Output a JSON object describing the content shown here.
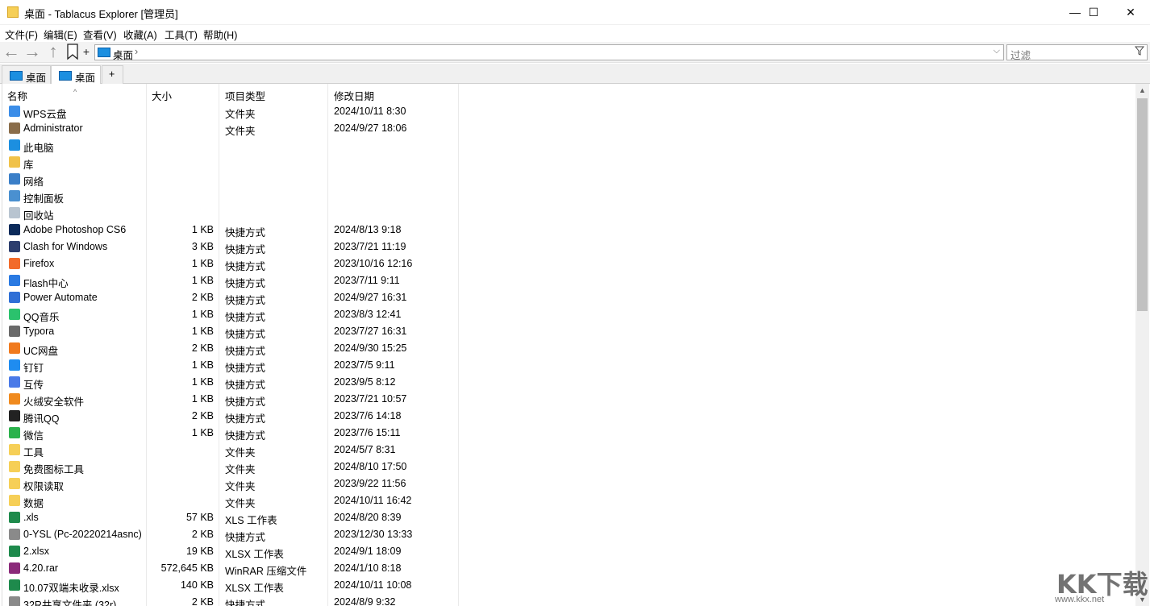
{
  "window": {
    "title": "桌面 - Tablacus Explorer [管理员]",
    "minimize": "—",
    "maximize": "☐",
    "close": "✕"
  },
  "menu": [
    "文件(F)",
    "编辑(E)",
    "查看(V)",
    "收藏(A)",
    "工具(T)",
    "帮助(H)"
  ],
  "nav": {
    "back": "←",
    "forward": "→",
    "up": "↑",
    "new_tab": "+"
  },
  "address": {
    "path": "桌面",
    "separator": "›",
    "dropdown": "⌵"
  },
  "filter": {
    "placeholder": "过滤",
    "icon": "filter-icon"
  },
  "tabs": [
    {
      "label": "桌面",
      "active": false
    },
    {
      "label": "桌面",
      "active": true
    },
    {
      "label": "+"
    }
  ],
  "columns": {
    "name": "名称",
    "size": "大小",
    "type": "项目类型",
    "date": "修改日期"
  },
  "files": [
    {
      "name": "WPS云盘",
      "size": "",
      "type": "文件夹",
      "date": "2024/10/11 8:30",
      "icon": "cloud-icon",
      "color": "#3b8de8"
    },
    {
      "name": "Administrator",
      "size": "",
      "type": "文件夹",
      "date": "2024/9/27 18:06",
      "icon": "user-folder-icon",
      "color": "#8a6d4a"
    },
    {
      "name": "此电脑",
      "size": "",
      "type": "",
      "date": "",
      "icon": "computer-icon",
      "color": "#1c8fe0"
    },
    {
      "name": "库",
      "size": "",
      "type": "",
      "date": "",
      "icon": "library-icon",
      "color": "#f0c24a"
    },
    {
      "name": "网络",
      "size": "",
      "type": "",
      "date": "",
      "icon": "network-icon",
      "color": "#3a7fc8"
    },
    {
      "name": "控制面板",
      "size": "",
      "type": "",
      "date": "",
      "icon": "control-panel-icon",
      "color": "#4a90d0"
    },
    {
      "name": "回收站",
      "size": "",
      "type": "",
      "date": "",
      "icon": "recycle-bin-icon",
      "color": "#b8c4d0"
    },
    {
      "name": "Adobe Photoshop CS6",
      "size": "1 KB",
      "type": "快捷方式",
      "date": "2024/8/13 9:18",
      "icon": "photoshop-icon",
      "color": "#0b2a5a"
    },
    {
      "name": "Clash for Windows",
      "size": "3 KB",
      "type": "快捷方式",
      "date": "2023/7/21 11:19",
      "icon": "clash-icon",
      "color": "#2d3e6e"
    },
    {
      "name": "Firefox",
      "size": "1 KB",
      "type": "快捷方式",
      "date": "2023/10/16 12:16",
      "icon": "firefox-icon",
      "color": "#f26b2a"
    },
    {
      "name": "Flash中心",
      "size": "1 KB",
      "type": "快捷方式",
      "date": "2023/7/11 9:11",
      "icon": "flash-icon",
      "color": "#2a7ae2"
    },
    {
      "name": "Power Automate",
      "size": "2 KB",
      "type": "快捷方式",
      "date": "2024/9/27 16:31",
      "icon": "power-automate-icon",
      "color": "#2f6fd6"
    },
    {
      "name": "QQ音乐",
      "size": "1 KB",
      "type": "快捷方式",
      "date": "2023/8/3 12:41",
      "icon": "qq-music-icon",
      "color": "#2bc26d"
    },
    {
      "name": "Typora",
      "size": "1 KB",
      "type": "快捷方式",
      "date": "2023/7/27 16:31",
      "icon": "typora-icon",
      "color": "#6a6a6a"
    },
    {
      "name": "UC网盘",
      "size": "2 KB",
      "type": "快捷方式",
      "date": "2024/9/30 15:25",
      "icon": "uc-drive-icon",
      "color": "#f07a1e"
    },
    {
      "name": "钉钉",
      "size": "1 KB",
      "type": "快捷方式",
      "date": "2023/7/5 9:11",
      "icon": "dingtalk-icon",
      "color": "#1f8cf0"
    },
    {
      "name": "互传",
      "size": "1 KB",
      "type": "快捷方式",
      "date": "2023/9/5 8:12",
      "icon": "transfer-icon",
      "color": "#4a7ae8"
    },
    {
      "name": "火绒安全软件",
      "size": "1 KB",
      "type": "快捷方式",
      "date": "2023/7/21 10:57",
      "icon": "huorong-icon",
      "color": "#f08a1e"
    },
    {
      "name": "腾讯QQ",
      "size": "2 KB",
      "type": "快捷方式",
      "date": "2023/7/6 14:18",
      "icon": "qq-icon",
      "color": "#222222"
    },
    {
      "name": "微信",
      "size": "1 KB",
      "type": "快捷方式",
      "date": "2023/7/6 15:11",
      "icon": "wechat-icon",
      "color": "#2bb24c"
    },
    {
      "name": "工具",
      "size": "",
      "type": "文件夹",
      "date": "2024/5/7 8:31",
      "icon": "folder-icon",
      "color": "#f6cf57"
    },
    {
      "name": "免费图标工具",
      "size": "",
      "type": "文件夹",
      "date": "2024/8/10 17:50",
      "icon": "folder-icon",
      "color": "#f6cf57"
    },
    {
      "name": "权限读取",
      "size": "",
      "type": "文件夹",
      "date": "2023/9/22 11:56",
      "icon": "folder-icon",
      "color": "#f6cf57"
    },
    {
      "name": "数据",
      "size": "",
      "type": "文件夹",
      "date": "2024/10/11 16:42",
      "icon": "folder-icon",
      "color": "#f6cf57"
    },
    {
      "name": ".xls",
      "size": "57 KB",
      "type": "XLS 工作表",
      "date": "2024/8/20 8:39",
      "icon": "spreadsheet-icon",
      "color": "#1e8a4c"
    },
    {
      "name": "0-YSL (Pc-20220214asnc)",
      "size": "2 KB",
      "type": "快捷方式",
      "date": "2023/12/30 13:33",
      "icon": "shortcut-icon",
      "color": "#8a8a8a"
    },
    {
      "name": "2.xlsx",
      "size": "19 KB",
      "type": "XLSX 工作表",
      "date": "2024/9/1 18:09",
      "icon": "spreadsheet-icon",
      "color": "#1e8a4c"
    },
    {
      "name": "4.20.rar",
      "size": "572,645 KB",
      "type": "WinRAR 压缩文件",
      "date": "2024/1/10 8:18",
      "icon": "rar-icon",
      "color": "#8b2a7a"
    },
    {
      "name": "10.07双端未收录.xlsx",
      "size": "140 KB",
      "type": "XLSX 工作表",
      "date": "2024/10/11 10:08",
      "icon": "spreadsheet-icon",
      "color": "#1e8a4c"
    },
    {
      "name": "32R共享文件夹 (32r)",
      "size": "2 KB",
      "type": "快捷方式",
      "date": "2024/8/9 9:32",
      "icon": "shortcut-icon",
      "color": "#8a8a8a"
    }
  ],
  "watermark": {
    "logo": "KK下载",
    "url": "www.kkx.net"
  }
}
